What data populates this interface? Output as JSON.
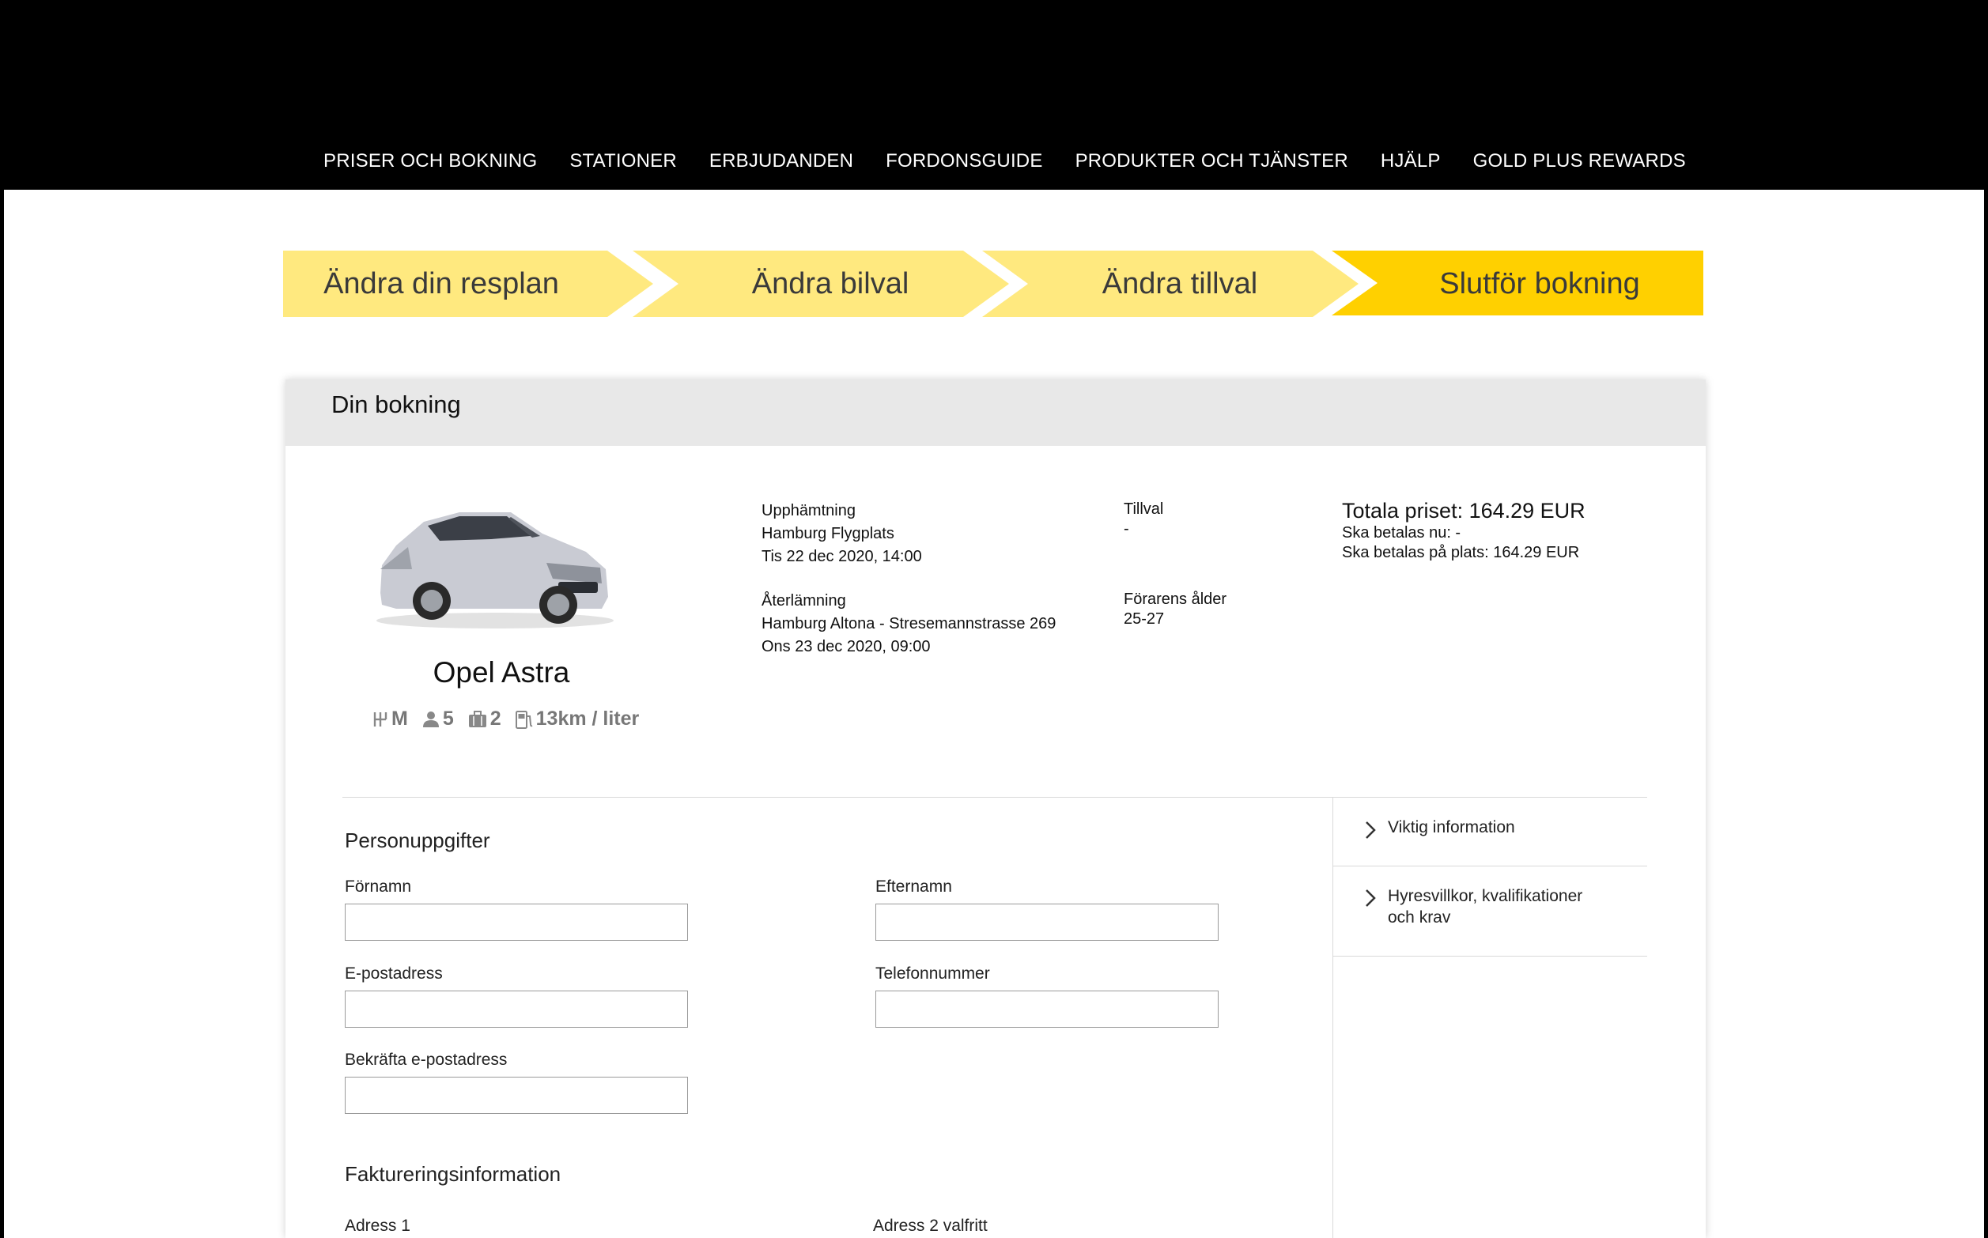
{
  "nav": {
    "items": [
      "PRISER OCH BOKNING",
      "STATIONER",
      "ERBJUDANDEN",
      "FORDONSGUIDE",
      "PRODUKTER OCH TJÄNSTER",
      "HJÄLP",
      "GOLD PLUS REWARDS"
    ]
  },
  "steps": [
    {
      "label": "Ändra din resplan",
      "color": "#ffe97f"
    },
    {
      "label": "Ändra bilval",
      "color": "#ffe97f"
    },
    {
      "label": "Ändra tillval",
      "color": "#ffe97f"
    },
    {
      "label": "Slutför bokning",
      "color": "#ffd000"
    }
  ],
  "booking": {
    "title": "Din bokning",
    "car": {
      "name": "Opel Astra",
      "transmission": "M",
      "seats": "5",
      "bags": "2",
      "fuel": "13km / liter"
    },
    "pickup": {
      "heading": "Upphämtning",
      "location": "Hamburg Flygplats",
      "datetime": "Tis 22 dec 2020, 14:00"
    },
    "return": {
      "heading": "Återlämning",
      "location": "Hamburg Altona - Stresemannstrasse 269",
      "datetime": "Ons 23 dec 2020, 09:00"
    },
    "extras": {
      "heading": "Tillval",
      "value": "-"
    },
    "driver_age": {
      "heading": "Förarens ålder",
      "value": "25-27"
    },
    "price": {
      "total": "Totala priset: 164.29 EUR",
      "pay_now": "Ska betalas nu: -",
      "pay_on_site": "Ska betalas på plats: 164.29 EUR"
    }
  },
  "personal": {
    "title": "Personuppgifter",
    "first_name": {
      "label": "Förnamn",
      "value": "",
      "placeholder": ""
    },
    "last_name": {
      "label": "Efternamn",
      "value": "",
      "placeholder": ""
    },
    "email": {
      "label": "E-postadress",
      "value": "",
      "placeholder": ""
    },
    "phone": {
      "label": "Telefonnummer",
      "value": "",
      "placeholder": ""
    },
    "confirm_email": {
      "label": "Bekräfta e-postadress",
      "value": "",
      "placeholder": ""
    }
  },
  "billing": {
    "title": "Faktureringsinformation",
    "address1_label": "Adress 1",
    "address2_label": "Adress 2 valfritt"
  },
  "sidebar": {
    "items": [
      {
        "label": "Viktig information"
      },
      {
        "label_line1": "Hyresvillkor, kvalifikationer",
        "label_line2": "och krav"
      }
    ]
  },
  "colors": {
    "header_bg": "#000000",
    "step_light": "#ffe97f",
    "step_active": "#ffd000",
    "card_header": "#e8e8e8"
  }
}
